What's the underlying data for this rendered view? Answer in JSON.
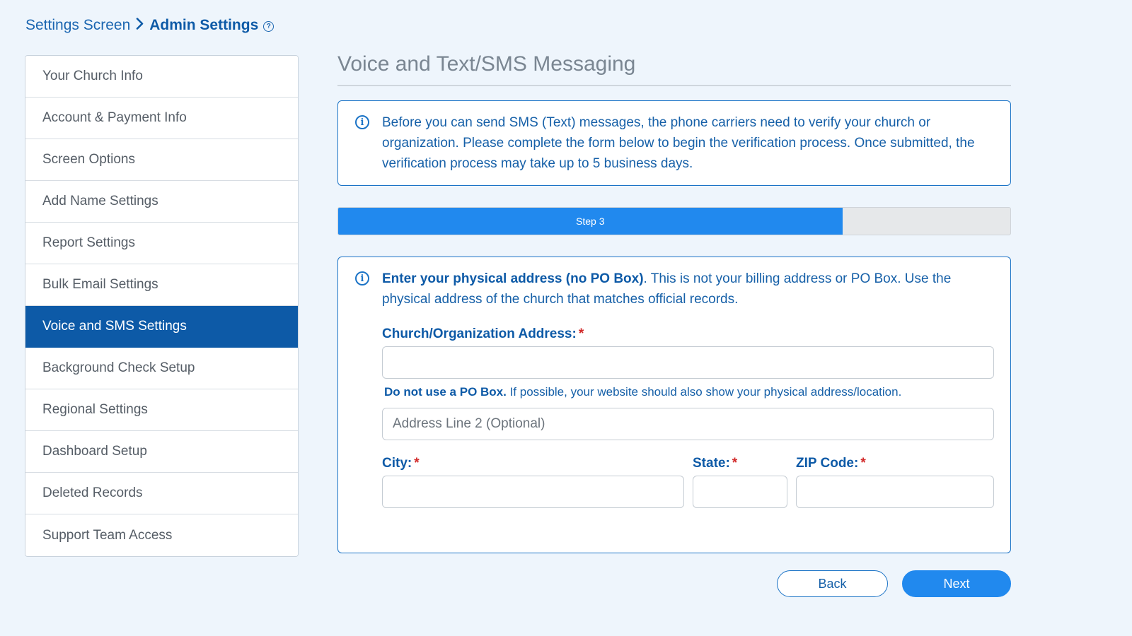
{
  "breadcrumb": {
    "parent": "Settings Screen",
    "current": "Admin Settings",
    "help_glyph": "?"
  },
  "sidebar": {
    "items": [
      {
        "label": "Your Church Info"
      },
      {
        "label": "Account & Payment Info"
      },
      {
        "label": "Screen Options"
      },
      {
        "label": "Add Name Settings"
      },
      {
        "label": "Report Settings"
      },
      {
        "label": "Bulk Email Settings"
      },
      {
        "label": "Voice and SMS Settings",
        "active": true
      },
      {
        "label": "Background Check Setup"
      },
      {
        "label": "Regional Settings"
      },
      {
        "label": "Dashboard Setup"
      },
      {
        "label": "Deleted Records"
      },
      {
        "label": "Support Team Access"
      }
    ]
  },
  "main": {
    "title": "Voice and Text/SMS Messaging",
    "info_text": "Before you can send SMS (Text) messages, the phone carriers need to verify your church or organization. Please complete the form below to begin the verification process. Once submitted, the verification process may take up to 5 business days.",
    "progress": {
      "label": "Step 3",
      "fraction": 0.75
    },
    "form": {
      "intro_bold": "Enter your physical address (no PO Box)",
      "intro_rest": ". This is not your billing address or PO Box. Use the physical address of the church that matches official records.",
      "address_label": "Church/Organization Address:",
      "address_value": "",
      "hint_bold": "Do not use a PO Box.",
      "hint_rest": " If possible, your website should also show your physical address/location.",
      "address2_placeholder": "Address Line 2 (Optional)",
      "city_label": "City:",
      "state_label": "State:",
      "zip_label": "ZIP Code:",
      "required_marker": "*"
    },
    "buttons": {
      "back": "Back",
      "next": "Next"
    }
  },
  "colors": {
    "accent": "#2189ee",
    "active_nav": "#0d5aa7",
    "required": "#d22a2a",
    "background": "#eef5fc"
  },
  "icons": {
    "info": "info-circle-icon",
    "help": "question-circle-icon",
    "separator": "chevron-right-icon"
  }
}
